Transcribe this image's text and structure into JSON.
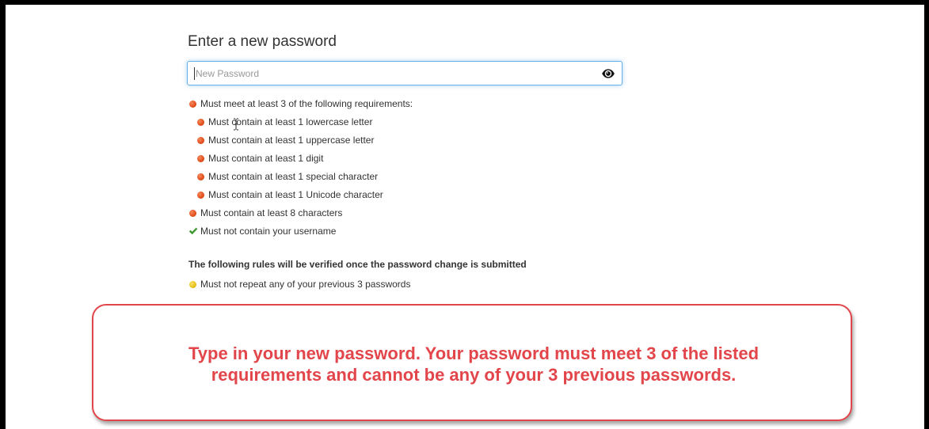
{
  "form": {
    "heading": "Enter a new password",
    "password_placeholder": "New Password",
    "password_value": "",
    "show_password_icon": "eye-icon"
  },
  "requirements": {
    "group_label": "Must meet at least 3 of the following requirements:",
    "group_status": "unmet",
    "sub_items": [
      {
        "label": "Must contain at least 1 lowercase letter",
        "status": "unmet"
      },
      {
        "label": "Must contain at least 1 uppercase letter",
        "status": "unmet"
      },
      {
        "label": "Must contain at least 1 digit",
        "status": "unmet"
      },
      {
        "label": "Must contain at least 1 special character",
        "status": "unmet"
      },
      {
        "label": "Must contain at least 1 Unicode character",
        "status": "unmet"
      }
    ],
    "length_label": "Must contain at least 8 characters",
    "length_status": "unmet",
    "username_label": "Must not contain your username",
    "username_status": "met"
  },
  "verification": {
    "title": "The following rules will be verified once the password change is submitted",
    "item_label": "Must not repeat any of your previous 3 passwords",
    "item_status": "pending"
  },
  "callout": {
    "line1": "Type in your new password. Your password must meet 3 of the listed",
    "line2": "requirements and cannot be any of your 3 previous passwords."
  },
  "colors": {
    "unmet": "#e4521f",
    "met": "#3c9a2e",
    "pending": "#e6c11a",
    "callout": "#e2454a",
    "focus": "#66afe9"
  }
}
